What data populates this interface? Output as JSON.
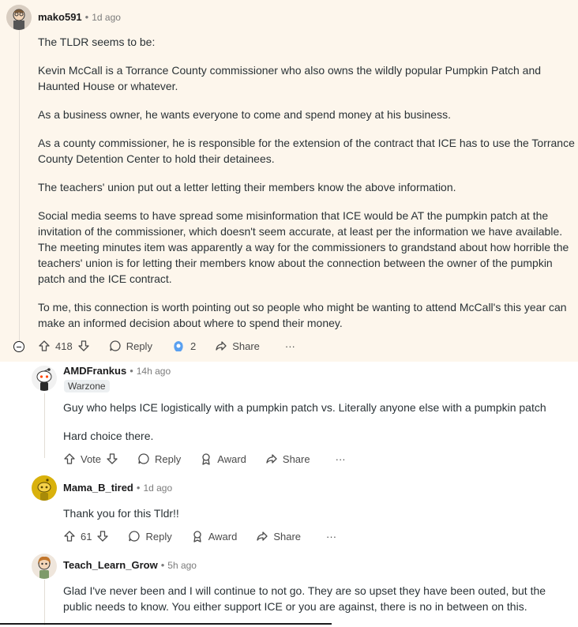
{
  "comments": [
    {
      "author": "mako591",
      "time": "1d ago",
      "paragraphs": [
        "The TLDR seems to be:",
        "Kevin McCall is a Torrance County commissioner who also owns the wildly popular Pumpkin Patch and Haunted House or whatever.",
        "As a business owner, he wants everyone to come and spend money at his business.",
        "As a county commissioner, he is responsible for the extension of the contract that ICE has to use the Torrance County Detention Center to hold their detainees.",
        "The teachers' union put out a letter letting their members know the above information.",
        "Social media seems to have spread some misinformation that ICE would be AT the pumpkin patch at the invitation of the commissioner, which doesn't seem accurate, at least per the information we have available. The meeting minutes item was apparently a way for the commissioners to grandstand about how horrible the teachers' union is for letting their members know about the connection between the owner of the pumpkin patch and the ICE contract.",
        "To me, this connection is worth pointing out so people who might be wanting to attend McCall's this year can make an informed decision about where to spend their money."
      ],
      "votes": "418",
      "reply": "Reply",
      "awards": "2",
      "share": "Share",
      "more": "···"
    },
    {
      "author": "AMDFrankus",
      "time": "14h ago",
      "flair": "Warzone",
      "paragraphs": [
        "Guy who helps ICE logistically with a pumpkin patch vs. Literally anyone else with a pumpkin patch",
        "Hard choice there."
      ],
      "votes": "Vote",
      "reply": "Reply",
      "award": "Award",
      "share": "Share",
      "more": "···"
    },
    {
      "author": "Mama_B_tired",
      "time": "1d ago",
      "paragraphs": [
        "Thank you for this Tldr!!"
      ],
      "votes": "61",
      "reply": "Reply",
      "award": "Award",
      "share": "Share",
      "more": "···"
    },
    {
      "author": "Teach_Learn_Grow",
      "time": "5h ago",
      "paragraphs": [
        "Glad I've never been and I will continue to not go. They are so upset they have been outed, but the public needs to know. You either support ICE or you are against, there is no in between on this."
      ]
    }
  ],
  "dot": "•",
  "icons": {
    "upvote": "upvote-icon",
    "downvote": "downvote-icon",
    "reply": "reply-bubble-icon",
    "award": "award-icon",
    "share": "share-arrow-icon",
    "collapse": "collapse-minus-icon"
  },
  "colors": {
    "highlight": "#fdf6ec",
    "award_blue": "#3b82f6",
    "mama_avatar": "#d9b10c"
  }
}
